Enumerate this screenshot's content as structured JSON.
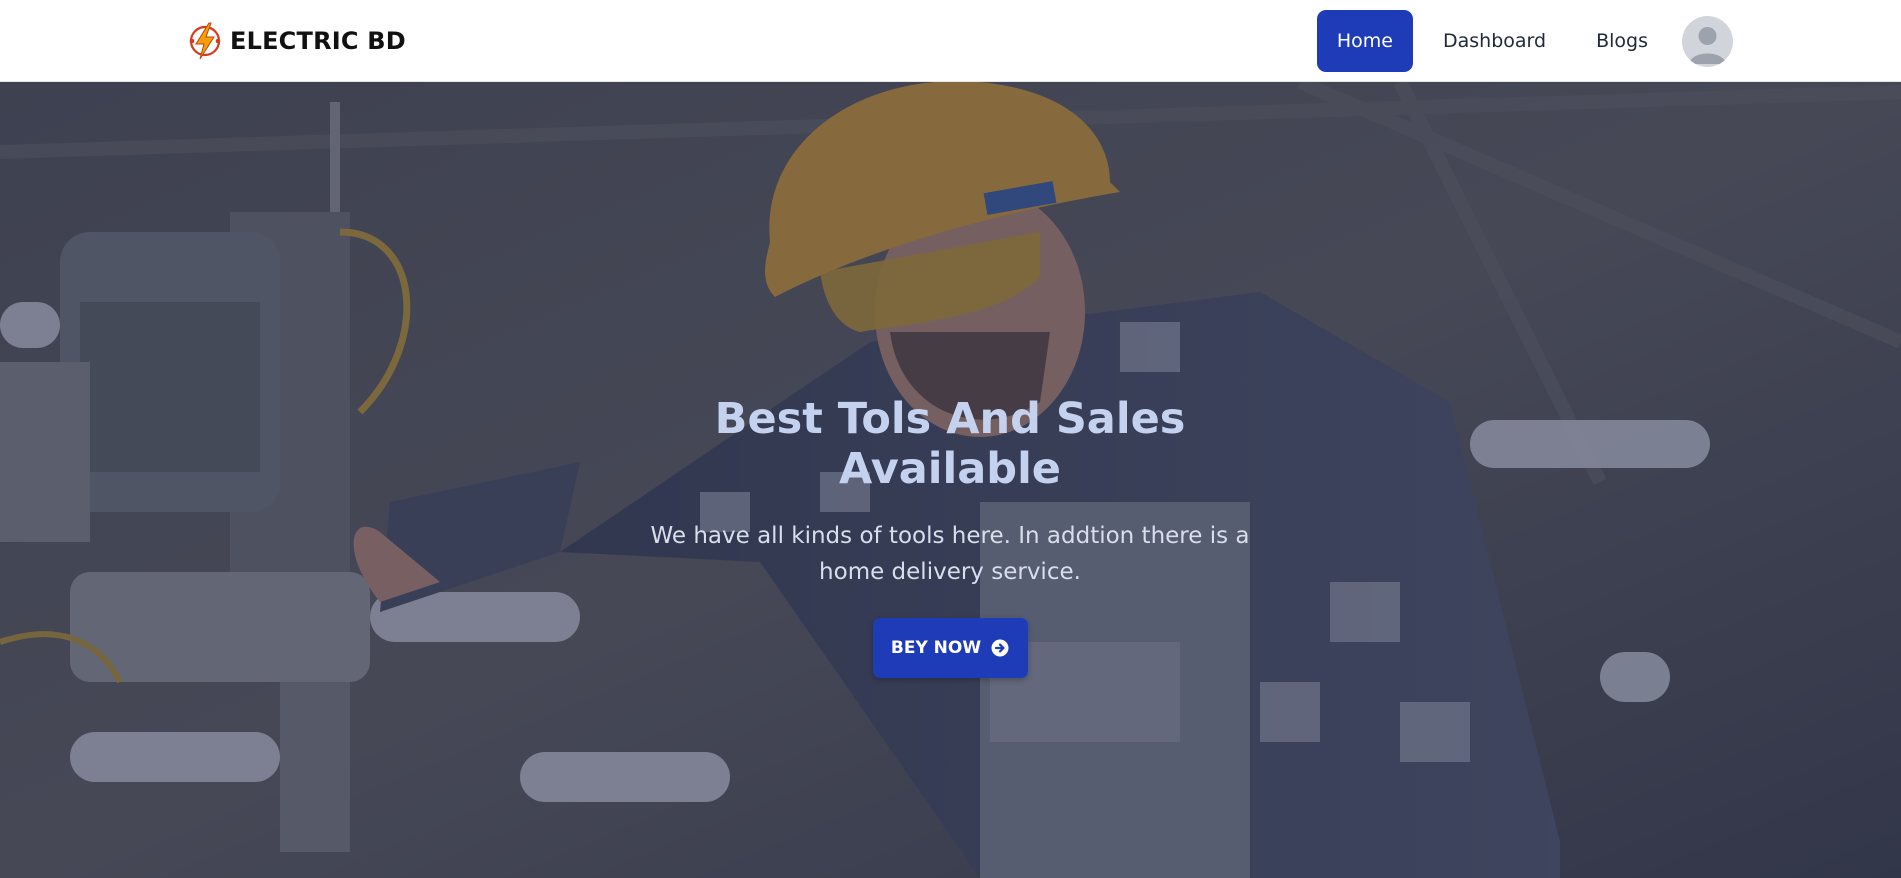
{
  "brand": {
    "name": "ELECTRIC BD",
    "logo_icon": "lightning-bolt-icon",
    "logo_color": "#f97316"
  },
  "nav": {
    "items": [
      {
        "label": "Home",
        "active": true
      },
      {
        "label": "Dashboard",
        "active": false
      },
      {
        "label": "Blogs",
        "active": false
      }
    ],
    "avatar_icon": "user-avatar-icon",
    "accent_color": "#1e3bb8"
  },
  "hero": {
    "title": "Best Tols And Sales Available",
    "text": "We have all kinds of tools here. In addtion there is a home delivery service.",
    "button_label": "BEY NOW",
    "button_icon": "arrow-circle-right-icon",
    "background_image": "factory worker in hard hat and safety glasses operating a drill press"
  }
}
